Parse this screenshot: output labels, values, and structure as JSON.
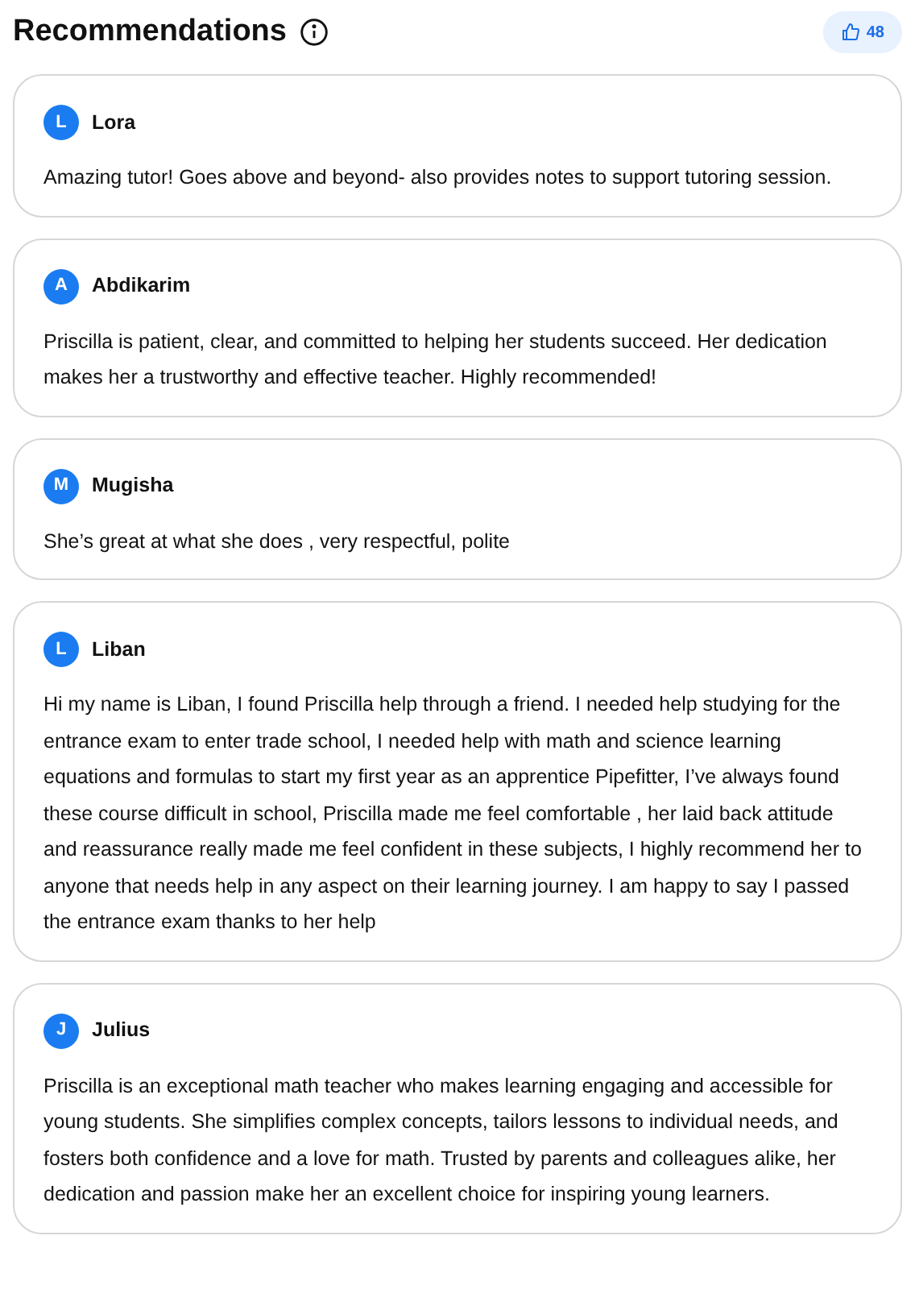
{
  "header": {
    "title": "Recommendations",
    "likes": "48"
  },
  "reviews": [
    {
      "initial": "L",
      "name": "Lora",
      "text": "Amazing tutor! Goes above and beyond- also provides notes to support tutoring session."
    },
    {
      "initial": "A",
      "name": "Abdikarim",
      "text": "Priscilla is patient, clear, and committed to helping her students succeed. Her dedication makes her a trustworthy and effective teacher. Highly recommended!"
    },
    {
      "initial": "M",
      "name": "Mugisha",
      "text": "She’s great at what she does , very respectful, polite"
    },
    {
      "initial": "L",
      "name": "Liban",
      "text": "Hi my name is Liban, I found Priscilla help through a friend. I needed help studying for the entrance exam to enter trade school, I needed help with math and science learning equations and formulas to start my first year as an apprentice Pipefitter, I’ve always found these course difficult in school, Priscilla made me feel comfortable , her laid back attitude and reassurance really made me feel confident in these subjects, I highly recommend her to anyone that needs help in any aspect on their learning journey. I am happy to say I passed the entrance exam thanks to her help"
    },
    {
      "initial": "J",
      "name": "Julius",
      "text": "Priscilla is an exceptional math teacher who makes learning engaging and accessible for young students. She simplifies complex concepts, tailors lessons to individual needs, and fosters both confidence and a love for math. Trusted by parents and colleagues alike, her dedication and passion make her an excellent choice for inspiring young learners."
    }
  ]
}
